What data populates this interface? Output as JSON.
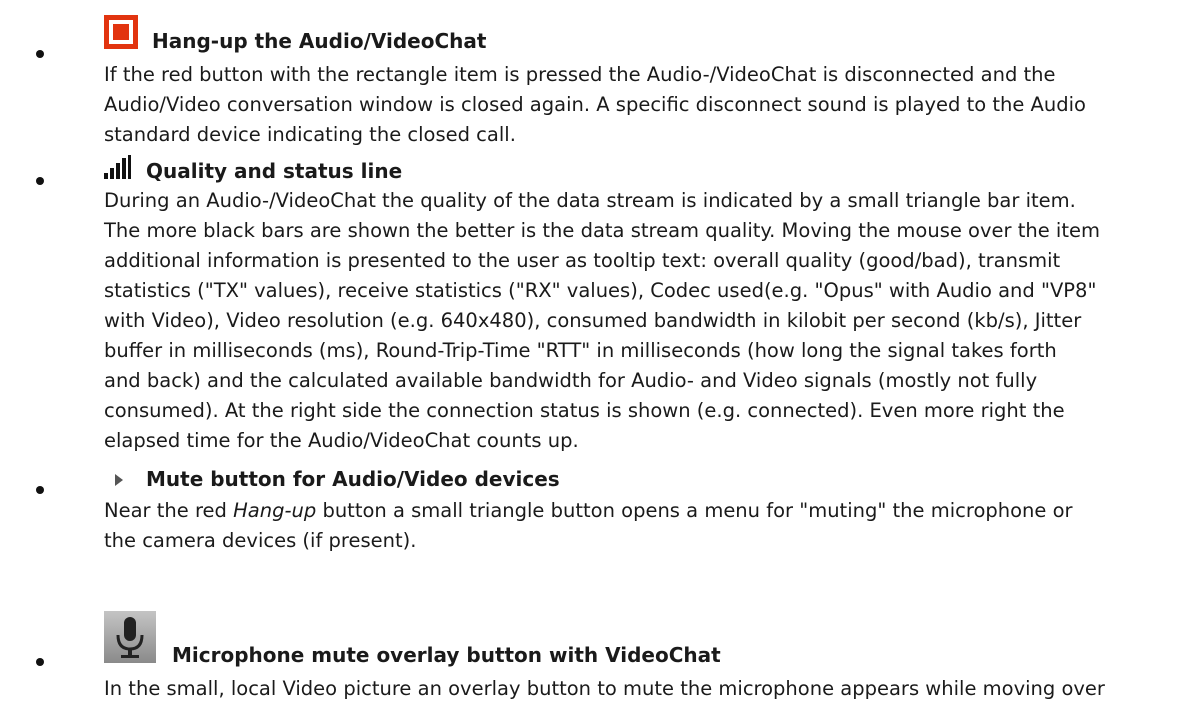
{
  "items": [
    {
      "title": "Hang-up the Audio/VideoChat",
      "icon": "stop-square-icon",
      "color": "#e2340f",
      "lines": [
        "If the red button with the rectangle item is pressed the Audio-/VideoChat is disconnected and the",
        "Audio/Video conversation window is closed again. A specific disconnect sound is played to the Audio",
        "standard device indicating the closed call."
      ]
    },
    {
      "title": "Quality and status line",
      "icon": "signal-bars-icon",
      "lines": [
        "During an Audio-/VideoChat the quality of the data stream is indicated by a small triangle bar item.",
        "The more black bars are shown the better is the data stream quality. Moving the mouse over the item",
        "additional information is presented to the user as tooltip text: overall quality (good/bad), transmit",
        "statistics (\"TX\" values), receive statistics (\"RX\" values), Codec used(e.g. \"Opus\" with Audio and \"VP8\"",
        "with Video), Video resolution (e.g. 640x480), consumed bandwidth in kilobit per second (kb/s), Jitter",
        "buffer in milliseconds (ms), Round-Trip-Time \"RTT\" in milliseconds (how long the signal takes forth",
        "and back) and the calculated available bandwidth for Audio- and Video signals (mostly not fully",
        "consumed). At the right side the connection status is shown (e.g. connected). Even more right the",
        "elapsed time for the Audio/VideoChat counts up."
      ]
    },
    {
      "title": "Mute button for Audio/Video devices",
      "icon": "triangle-right-icon",
      "line1_before": "Near the red ",
      "line1_em": "Hang-up",
      "line1_after": " button a small triangle button opens a menu for \"muting\" the microphone or",
      "lines": [
        "the camera devices (if present)."
      ]
    },
    {
      "title": "Microphone mute overlay button with VideoChat",
      "icon": "microphone-icon",
      "lines": [
        "In the small, local Video picture an overlay button to mute the microphone appears while moving over"
      ]
    }
  ]
}
